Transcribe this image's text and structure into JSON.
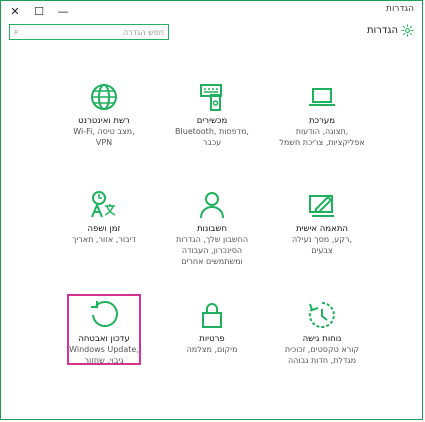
{
  "window": {
    "title": "הגדרות",
    "controls": {
      "close": "✕",
      "maximize": "☐",
      "minimize": "—"
    }
  },
  "header": {
    "title": "הגדרות"
  },
  "search": {
    "placeholder": "חפש הגדרה"
  },
  "tiles": [
    {
      "name": "מערכת",
      "desc": [
        "תצוגה, הודעות,",
        "אפליקציות, צריכת חשמל"
      ],
      "icon": "laptop-icon"
    },
    {
      "name": "מכשירים",
      "desc": [
        "Bluetooth, מדפסות,",
        "עכבר"
      ],
      "icon": "devices-icon"
    },
    {
      "name": "רשת ואינטרנט",
      "desc": [
        "Wi-Fi, מצב טיסה,",
        "VPN"
      ],
      "icon": "globe-icon"
    },
    {
      "name": "התאמה אישית",
      "desc": [
        "רקע, מסך נעילה,",
        "צבעים"
      ],
      "icon": "personalization-icon"
    },
    {
      "name": "חשבונות",
      "desc": [
        "החשבון שלך, הגדרות",
        "הסינכרון, העבודה",
        "ומשתמשים אחרים"
      ],
      "icon": "person-icon"
    },
    {
      "name": "זמן ושפה",
      "desc": [
        "דיבור, אזור, תאריך"
      ],
      "icon": "time-language-icon"
    },
    {
      "name": "נוחות גישה",
      "desc": [
        "קורא טקסטים, זכוכית",
        "מגדלת, חדות גבוהה"
      ],
      "icon": "ease-of-access-icon"
    },
    {
      "name": "פרטיות",
      "desc": [
        "מיקום, מצלמה"
      ],
      "icon": "lock-icon"
    },
    {
      "name": "עדכון ואבטחה",
      "desc": [
        "Windows Update,",
        "גיבוי, שחזור"
      ],
      "icon": "update-icon"
    }
  ]
}
